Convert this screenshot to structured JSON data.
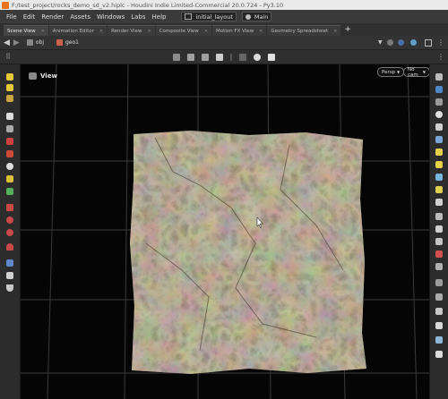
{
  "window": {
    "title": "F:/test_project/rocks_demo_sd_v2.hiplc - Houdini Indie Limited-Commercial 20.0.724 - Py3.10"
  },
  "menu": {
    "items": [
      "File",
      "Edit",
      "Render",
      "Assets",
      "Windows",
      "Labs",
      "Help"
    ],
    "desktop": "initial_layout",
    "context": "Main"
  },
  "tabs": [
    "Scene View",
    "Animation Editor",
    "Render View",
    "Composite View",
    "Motion FX View",
    "Geometry Spreadsheet"
  ],
  "path": {
    "obj": "obj",
    "geo": "geo1"
  },
  "viewport": {
    "label": "View",
    "camera_mode": "Persp",
    "camera": "No cam"
  },
  "colors": {
    "accent": "#e8731a",
    "viewport_bg": "#050505",
    "grid": "#3a3a3a",
    "rock_base": "#6e5e48"
  }
}
